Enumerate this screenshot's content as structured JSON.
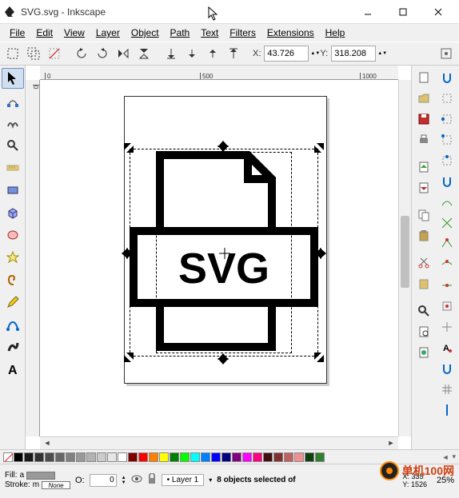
{
  "window": {
    "title": "SVG.svg - Inkscape"
  },
  "menus": [
    "File",
    "Edit",
    "View",
    "Layer",
    "Object",
    "Path",
    "Text",
    "Filters",
    "Extensions",
    "Help"
  ],
  "toolbar": {
    "coord_x_label": "X:",
    "coord_x": "43.726",
    "coord_y_label": "Y:",
    "coord_y": "318.208"
  },
  "ruler_h": [
    "0",
    "500",
    "1000"
  ],
  "ruler_v": [
    "0"
  ],
  "canvas": {
    "svg_text": "SVG"
  },
  "status": {
    "fill_label": "Fill:",
    "fill_value": "a",
    "stroke_label": "Stroke:",
    "stroke_value": "m",
    "stroke_text": "None",
    "opacity_label": "O:",
    "opacity_value": "0",
    "layer": "Layer 1",
    "message": "8 objects selected of",
    "x_label": "X:",
    "x_val": "335",
    "y_label": "Y:",
    "y_val": "1526",
    "zoom": "25%"
  },
  "watermark": "单机100网"
}
